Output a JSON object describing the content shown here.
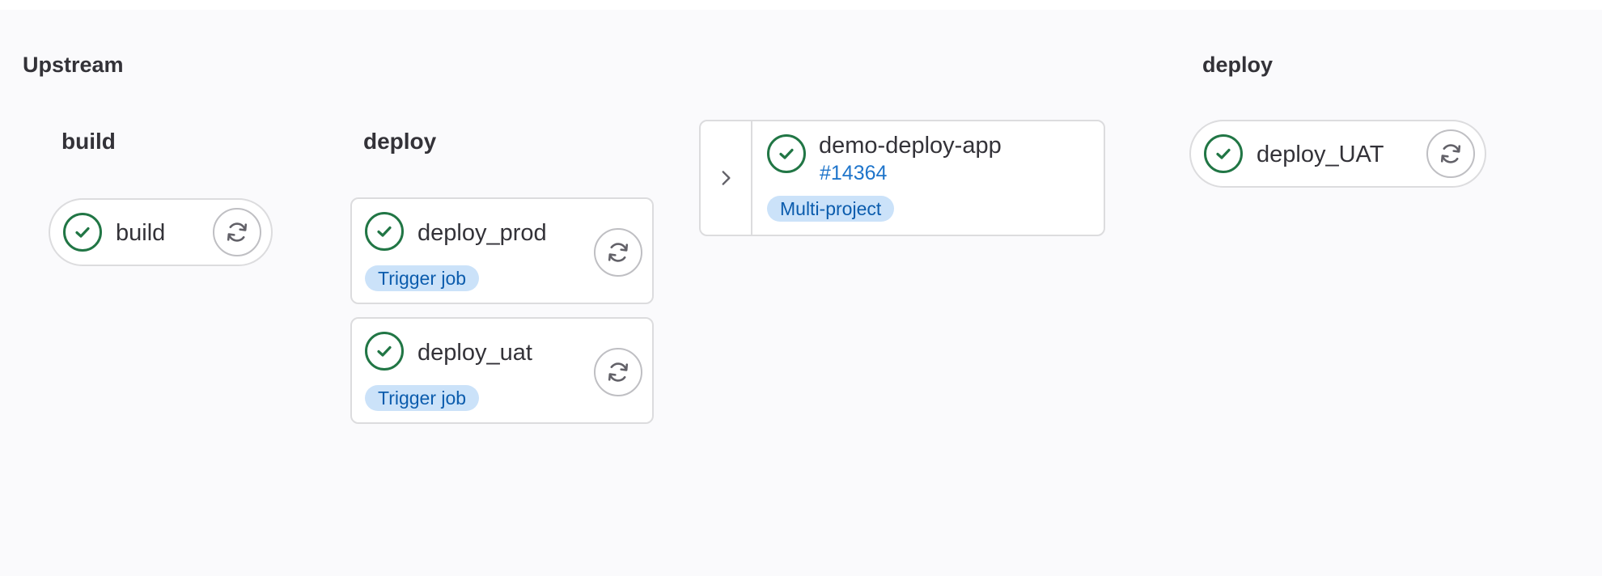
{
  "upstream": {
    "title": "Upstream",
    "stages": [
      {
        "name": "build",
        "jobs": [
          {
            "name": "build",
            "status": "success",
            "badge": null
          }
        ]
      },
      {
        "name": "deploy",
        "jobs": [
          {
            "name": "deploy_prod",
            "status": "success",
            "badge": "Trigger job"
          },
          {
            "name": "deploy_uat",
            "status": "success",
            "badge": "Trigger job"
          }
        ]
      }
    ]
  },
  "linked_pipeline": {
    "project": "demo-deploy-app",
    "id": "#14364",
    "badge": "Multi-project",
    "status": "success"
  },
  "downstream": {
    "stage": "deploy",
    "jobs": [
      {
        "name": "deploy_UAT",
        "status": "success"
      }
    ]
  },
  "colors": {
    "success": "#217645",
    "badge_bg": "#cbe2f9",
    "badge_text": "#0b5cad",
    "link": "#1f75cb",
    "border": "#dcdcde"
  },
  "icons": {
    "status": "check-circle-icon",
    "retry": "retry-icon",
    "expand": "chevron-right-icon"
  }
}
